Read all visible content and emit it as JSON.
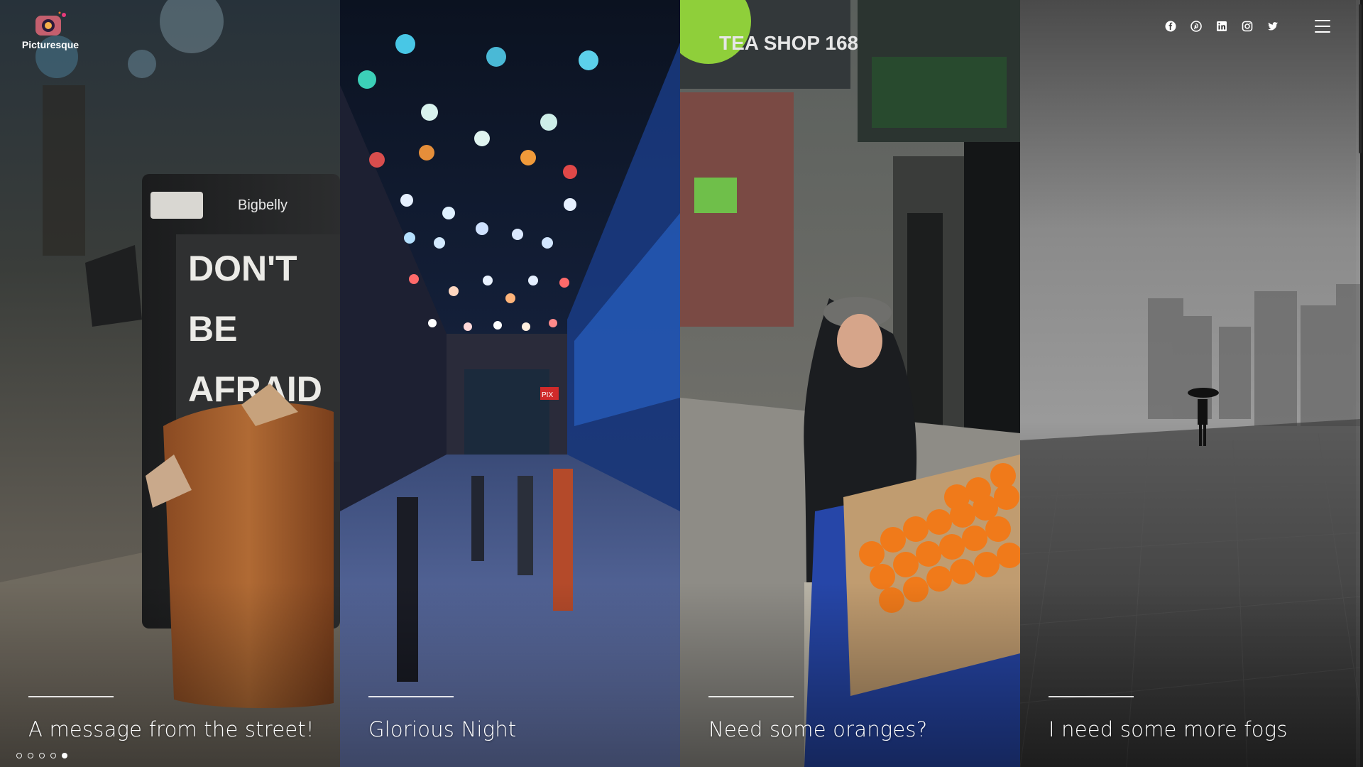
{
  "brand": {
    "name": "Picturesque",
    "logo_icon": "camera-logo-icon"
  },
  "social": [
    {
      "name": "facebook-icon"
    },
    {
      "name": "pinterest-icon"
    },
    {
      "name": "linkedin-icon"
    },
    {
      "name": "instagram-icon"
    },
    {
      "name": "twitter-icon"
    }
  ],
  "menu": {
    "icon": "hamburger-menu-icon"
  },
  "slides": [
    {
      "title": "A message from the street!",
      "sign_brand": "Bigbelly",
      "sign_text": [
        "DON'T",
        "BE",
        "AFRAID"
      ]
    },
    {
      "title": "Glorious Night",
      "sign_text": [
        "PIX"
      ]
    },
    {
      "title": "Need some oranges?",
      "sign_text": [
        "TEA SHOP 168"
      ]
    },
    {
      "title": "I need some more fogs"
    }
  ],
  "pagination": {
    "count": 5,
    "active_index": 4
  },
  "colors": {
    "accent": "#ffffff",
    "logo_orange": "#f47a2a",
    "logo_purple": "#8a3fc2"
  }
}
